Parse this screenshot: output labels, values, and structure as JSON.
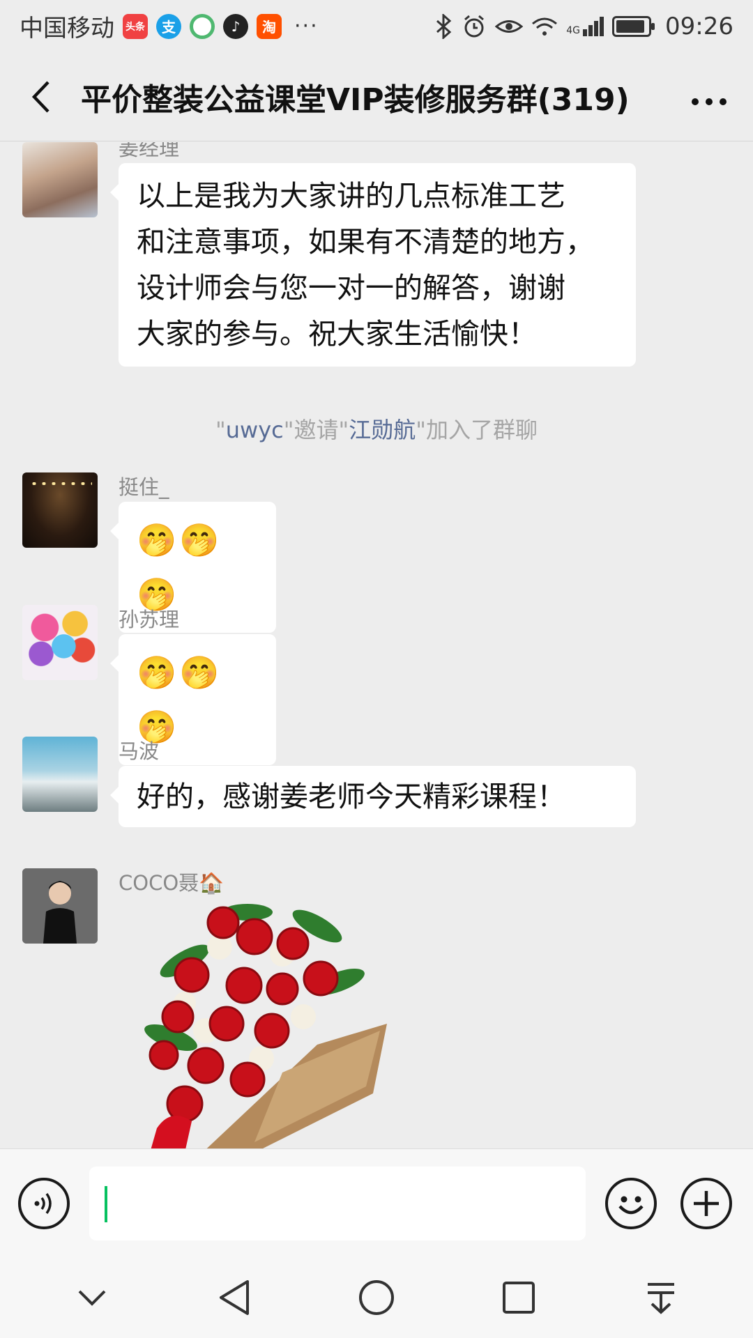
{
  "status_bar": {
    "carrier": "中国移动",
    "apps": [
      {
        "icon": "toutiao-app-icon",
        "label": "头条",
        "color": "#f04142"
      },
      {
        "icon": "alipay-app-icon",
        "label": "支",
        "color": "#1aa0e8"
      },
      {
        "icon": "app-circle-icon",
        "label": "",
        "color": "#4fb870"
      },
      {
        "icon": "tiktok-app-icon",
        "label": "♪",
        "color": "#222222"
      },
      {
        "icon": "taobao-app-icon",
        "label": "淘",
        "color": "#ff5000"
      }
    ],
    "more": "···",
    "network": "4G",
    "time": "09:26"
  },
  "header": {
    "title": "平价整装公益课堂VIP装修服务群(319)",
    "more": "···"
  },
  "messages": {
    "jiang": {
      "sender": "姜经理",
      "text_lines": [
        "以上是我为大家讲的几点标准工艺",
        "和注意事项，如果有不清楚的地方，",
        "设计师会与您一对一的解答，谢谢",
        "大家的参与。祝大家生活愉快！"
      ]
    },
    "system": {
      "q1": "\"",
      "inviter": "uwyc",
      "mid": "\"邀请\"",
      "invitee": "江勋航",
      "end": "\"加入了群聊"
    },
    "ting": {
      "sender": "挺住_",
      "emoji": "🤭🤭🤭"
    },
    "sun": {
      "sender": "孙苏理",
      "emoji": "🤭🤭🤭"
    },
    "ma": {
      "sender": "马波",
      "text": "好的，感谢姜老师今天精彩课程！"
    },
    "coco": {
      "sender": "COCO聂🏠",
      "sticker": "rose-bouquet"
    }
  },
  "input": {
    "placeholder": ""
  },
  "colors": {
    "accent": "#07c160",
    "link": "#576b95",
    "background": "#ededed"
  }
}
